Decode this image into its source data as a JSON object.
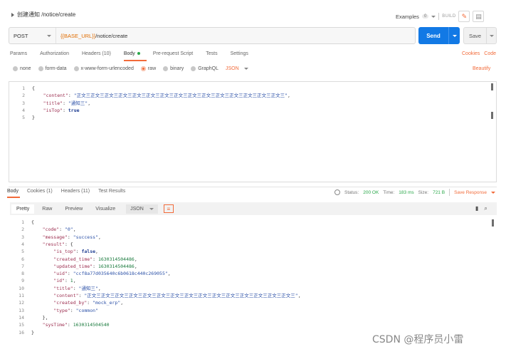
{
  "request": {
    "title": "创建通知 /notice/create",
    "examples_label": "Examples",
    "examples_count": "0",
    "build_label": "BUILD",
    "method": "POST",
    "url_var": "{{BASE_URL}}",
    "url_path": "/notice/create",
    "send_label": "Send",
    "save_label": "Save"
  },
  "request_tabs": [
    {
      "label": "Params"
    },
    {
      "label": "Authorization"
    },
    {
      "label": "Headers (10)"
    },
    {
      "label": "Body"
    },
    {
      "label": "Pre-request Script"
    },
    {
      "label": "Tests"
    },
    {
      "label": "Settings"
    }
  ],
  "links": {
    "cookies": "Cookies",
    "code": "Code",
    "beautify": "Beautify"
  },
  "body_types": [
    {
      "label": "none"
    },
    {
      "label": "form-data"
    },
    {
      "label": "x-www-form-urlencoded"
    },
    {
      "label": "raw"
    },
    {
      "label": "binary"
    },
    {
      "label": "GraphQL"
    }
  ],
  "body_format": "JSON",
  "request_body": [
    {
      "n": "1",
      "t": "{"
    },
    {
      "n": "2",
      "k": "\"content\"",
      "sep": ": ",
      "v": "\"正文三正文三正文三正文三正文三正文三正文三正文三正文三正文三正文三正文三正文三正文三正文三\"",
      "end": ",",
      "vt": "str",
      "indent": "    "
    },
    {
      "n": "3",
      "k": "\"title\"",
      "sep": ": ",
      "v": "\"通知三\"",
      "end": ",",
      "vt": "str",
      "indent": "    "
    },
    {
      "n": "4",
      "k": "\"isTop\"",
      "sep": ": ",
      "v": "true",
      "end": "",
      "vt": "bool",
      "indent": "    "
    },
    {
      "n": "5",
      "t": "}"
    }
  ],
  "response_tabs": [
    {
      "label": "Body"
    },
    {
      "label": "Cookies (1)"
    },
    {
      "label": "Headers (11)"
    },
    {
      "label": "Test Results"
    }
  ],
  "response_status": {
    "status_label": "Status:",
    "status_value": "200 OK",
    "time_label": "Time:",
    "time_value": "183 ms",
    "size_label": "Size:",
    "size_value": "721 B",
    "save_response": "Save Response"
  },
  "response_views": [
    {
      "label": "Pretty"
    },
    {
      "label": "Raw"
    },
    {
      "label": "Preview"
    },
    {
      "label": "Visualize"
    }
  ],
  "response_format": "JSON",
  "response_body": [
    {
      "n": "1",
      "t": "{"
    },
    {
      "n": "2",
      "indent": "    ",
      "k": "\"code\"",
      "sep": ": ",
      "v": "\"0\"",
      "end": ",",
      "vt": "str"
    },
    {
      "n": "3",
      "indent": "    ",
      "k": "\"message\"",
      "sep": ": ",
      "v": "\"success\"",
      "end": ",",
      "vt": "str"
    },
    {
      "n": "4",
      "indent": "    ",
      "k": "\"result\"",
      "sep": ": ",
      "v": "{",
      "end": "",
      "vt": "plain"
    },
    {
      "n": "5",
      "indent": "        ",
      "k": "\"is_top\"",
      "sep": ": ",
      "v": "false",
      "end": ",",
      "vt": "bool"
    },
    {
      "n": "6",
      "indent": "        ",
      "k": "\"created_time\"",
      "sep": ": ",
      "v": "1630314504486",
      "end": ",",
      "vt": "num"
    },
    {
      "n": "7",
      "indent": "        ",
      "k": "\"updated_time\"",
      "sep": ": ",
      "v": "1630314504486",
      "end": ",",
      "vt": "num"
    },
    {
      "n": "8",
      "indent": "        ",
      "k": "\"uid\"",
      "sep": ": ",
      "v": "\"ccf8a77d035640c6b0618c440c269055\"",
      "end": ",",
      "vt": "str"
    },
    {
      "n": "9",
      "indent": "        ",
      "k": "\"id\"",
      "sep": ": ",
      "v": "1",
      "end": ",",
      "vt": "num"
    },
    {
      "n": "10",
      "indent": "        ",
      "k": "\"title\"",
      "sep": ": ",
      "v": "\"通知三\"",
      "end": ",",
      "vt": "str"
    },
    {
      "n": "11",
      "indent": "        ",
      "k": "\"content\"",
      "sep": ": ",
      "v": "\"正文三正文三正文三正文三正文三正文三正文三正文三正文三正文三正文三正文三正文三正文三正文三\"",
      "end": ",",
      "vt": "str"
    },
    {
      "n": "12",
      "indent": "        ",
      "k": "\"created_by\"",
      "sep": ": ",
      "v": "\"mock_erp\"",
      "end": ",",
      "vt": "str"
    },
    {
      "n": "13",
      "indent": "        ",
      "k": "\"type\"",
      "sep": ": ",
      "v": "\"common\"",
      "end": "",
      "vt": "str"
    },
    {
      "n": "14",
      "indent": "    ",
      "t": "},"
    },
    {
      "n": "15",
      "indent": "    ",
      "k": "\"sysTime\"",
      "sep": ": ",
      "v": "1630314504540",
      "end": "",
      "vt": "num"
    },
    {
      "n": "16",
      "t": "}"
    }
  ],
  "watermark": "CSDN @程序员小雷",
  "colors": {
    "accent": "#f26b3a",
    "send": "#1279e5",
    "status_ok": "#2aa84a"
  }
}
